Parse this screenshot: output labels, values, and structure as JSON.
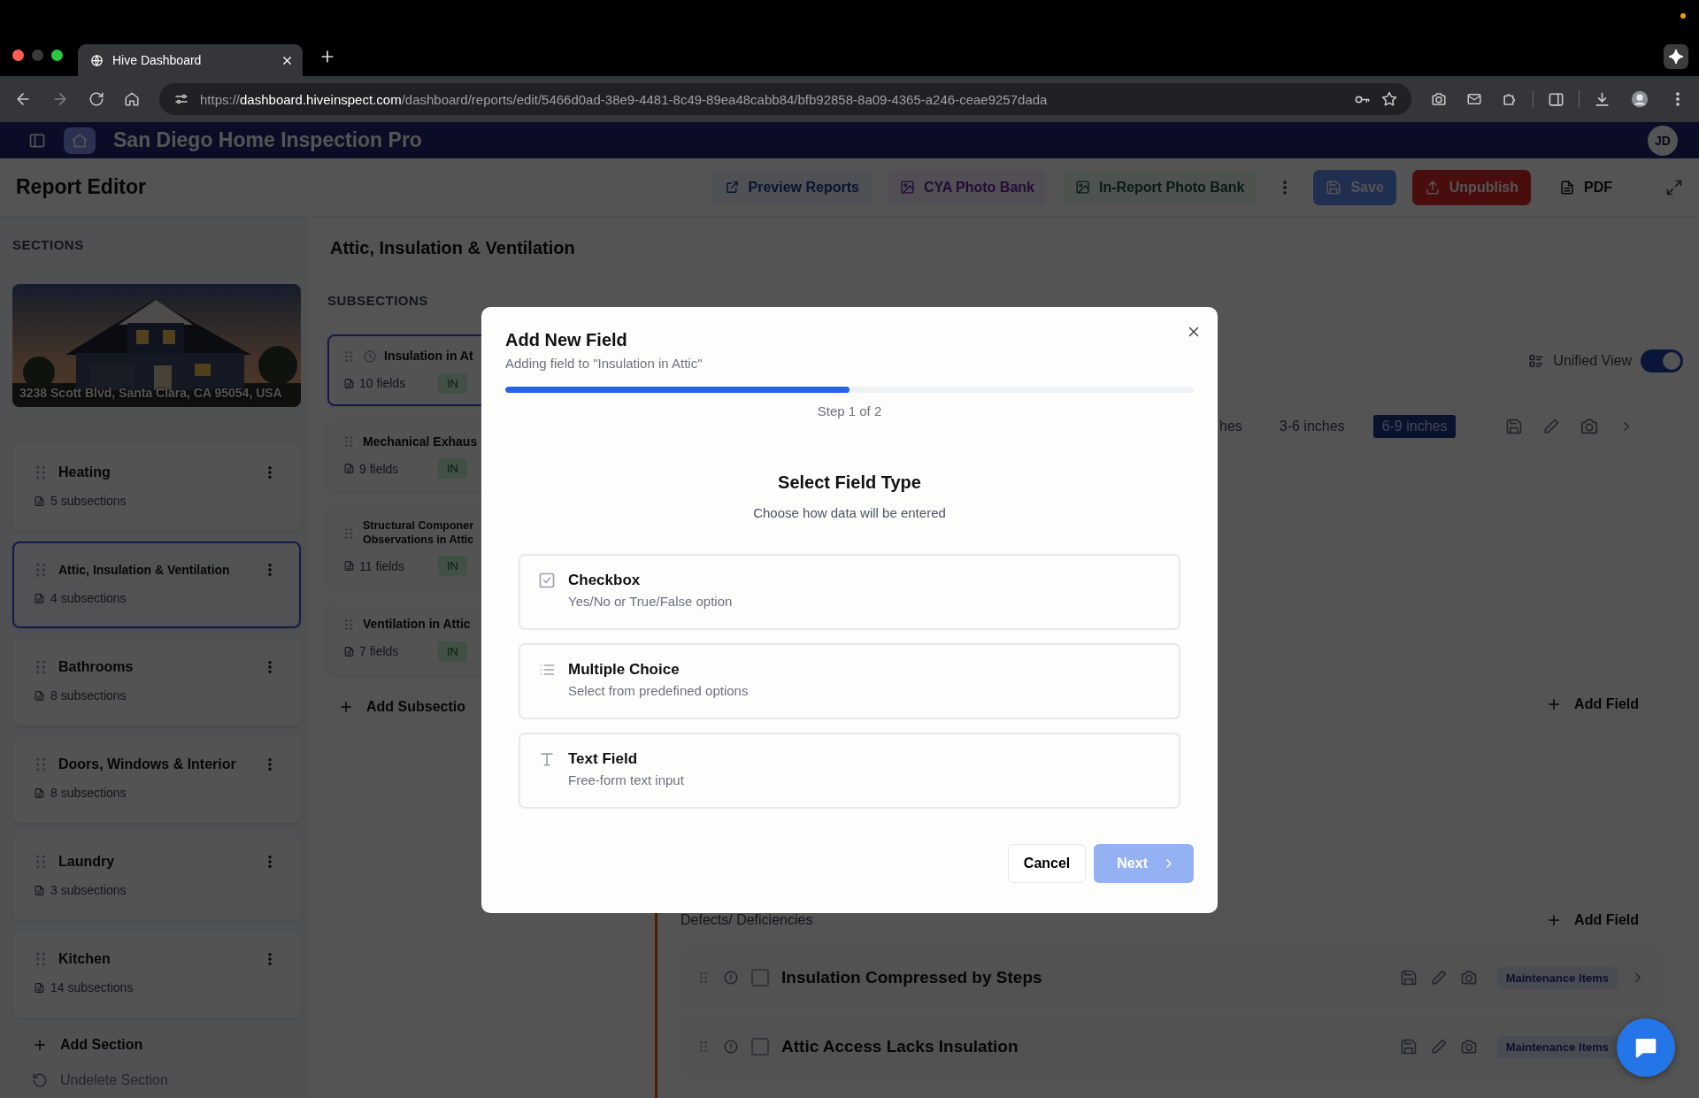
{
  "browser": {
    "tab_title": "Hive Dashboard",
    "url_scheme": "https://",
    "url_host": "dashboard.hiveinspect.com",
    "url_path": "/dashboard/reports/edit/5466d0ad-38e9-4481-8c49-89ea48cabb84/bfb92858-8a09-4365-a246-ceae9257dada"
  },
  "app_header": {
    "company": "San Diego Home Inspection Pro",
    "avatar": "JD"
  },
  "editor": {
    "title": "Report Editor",
    "links": [
      {
        "kind": "info",
        "label": "Preview Reports"
      },
      {
        "kind": "accent",
        "label": "CYA Photo Bank"
      },
      {
        "kind": "success",
        "label": "In-Report Photo Bank"
      }
    ],
    "buttons": [
      {
        "kind": "primary",
        "label": "Save",
        "disabled": true
      },
      {
        "kind": "danger",
        "label": "Unpublish",
        "disabled": false
      },
      {
        "kind": "plain",
        "label": "PDF",
        "disabled": false
      }
    ]
  },
  "sections": {
    "heading": "SECTIONS",
    "property": {
      "kind": "picture",
      "address": "3238 Scott Blvd, Santa Clara, CA 95054, USA"
    },
    "items": [
      {
        "name": "Heating",
        "count": "5 subsections",
        "selected": false
      },
      {
        "name": "Attic, Insulation & Ventilation",
        "count": "4 subsections",
        "selected": true
      },
      {
        "name": "Bathrooms",
        "count": "8 subsections",
        "selected": false
      },
      {
        "name": "Doors, Windows & Interior",
        "count": "8 subsections",
        "selected": false
      },
      {
        "name": "Laundry",
        "count": "3 subsections",
        "selected": false
      },
      {
        "name": "Kitchen",
        "count": "14 subsections",
        "selected": false
      }
    ],
    "add": "Add Section",
    "undelete": "Undelete Section"
  },
  "content": {
    "title": "Attic, Insulation & Ventilation"
  },
  "subsections": {
    "heading": "SUBSECTIONS",
    "items": [
      {
        "lines": [
          "Insulation in At"
        ],
        "fields": "10 fields",
        "badge": "IN",
        "selected": true
      },
      {
        "lines": [
          "Mechanical Exhaus"
        ],
        "fields": "9 fields",
        "badge": "IN",
        "selected": false
      },
      {
        "lines": [
          "Structural Componer",
          "Observations in Attic"
        ],
        "fields": "11 fields",
        "badge": "IN",
        "selected": false
      },
      {
        "lines": [
          "Ventilation in Attic"
        ],
        "fields": "7 fields",
        "badge": "IN",
        "selected": false
      }
    ],
    "add": "Add Subsectio"
  },
  "detail": {
    "view_toggle": {
      "label": "Unified View",
      "on": true
    },
    "options": [
      {
        "label": "hes",
        "selected": false
      },
      {
        "label": "3-6 inches",
        "selected": false
      },
      {
        "label": "6-9 inches",
        "selected": true
      }
    ],
    "add_field": "Add Field",
    "defects": {
      "title": "Defects/ Deficiencies",
      "add_field": "Add Field",
      "rows": [
        {
          "title": "Insulation Compressed by Steps",
          "checked": false,
          "tag": "Maintenance Items"
        },
        {
          "title": "Attic Access Lacks Insulation",
          "checked": false,
          "tag": "Maintenance Items"
        }
      ]
    }
  },
  "modal": {
    "title": "Add New Field",
    "subtitle": "Adding field to \"Insulation in Attic\"",
    "progress": {
      "level": 0.5
    },
    "step": "Step 1 of 2",
    "heading": "Select Field Type",
    "hint": "Choose how data will be entered",
    "options": [
      {
        "kind": "checkbox",
        "title": "Checkbox",
        "description": "Yes/No or True/False option",
        "selected": false
      },
      {
        "kind": "choice",
        "title": "Multiple Choice",
        "description": "Select from predefined options",
        "selected": false
      },
      {
        "kind": "text",
        "title": "Text Field",
        "description": "Free-form text input",
        "selected": false
      }
    ],
    "cancel": "Cancel",
    "next": {
      "label": "Next",
      "disabled": true
    }
  }
}
